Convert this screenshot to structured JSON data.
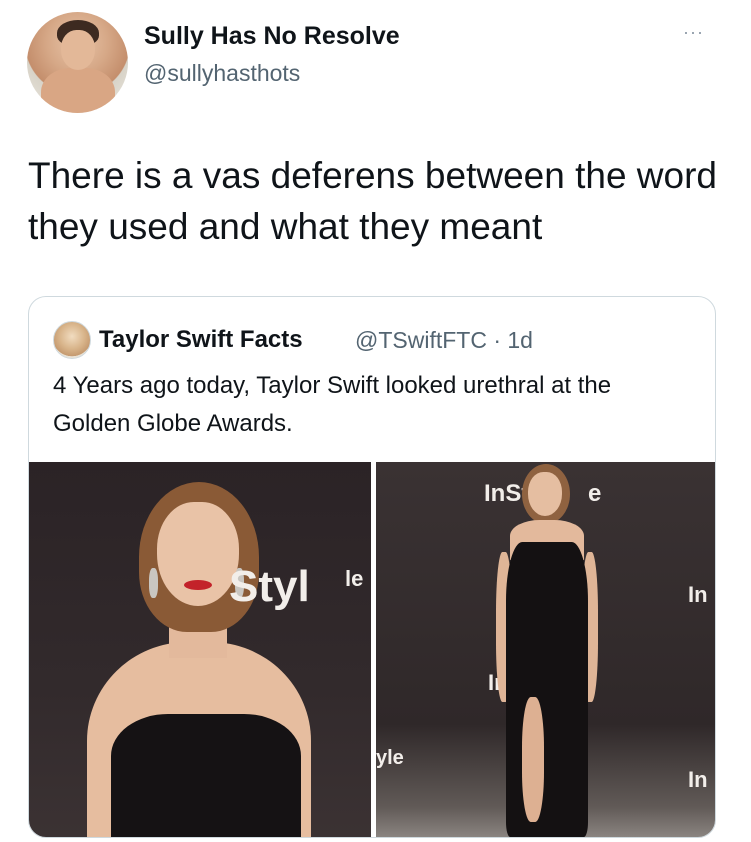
{
  "tweet": {
    "author_name": "Sully Has No Resolve",
    "author_handle": "@sullyhasthots",
    "more_label": "···",
    "text": "There is a vas deferens between the word they used and what they meant"
  },
  "quoted_tweet": {
    "author_name": "Taylor Swift Facts",
    "meta": "@TSwiftFTC · 1d",
    "text": "4 Years ago today, Taylor Swift looked urethral at the Golden Globe Awards."
  },
  "photos": {
    "left_backdrop": [
      "Styl",
      "le",
      "yle"
    ],
    "right_backdrop": [
      "InSt",
      "e",
      "In",
      "In",
      "In"
    ]
  }
}
